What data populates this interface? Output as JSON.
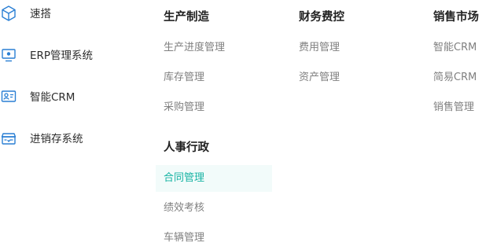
{
  "sidebar": {
    "items": [
      {
        "label": "速搭",
        "icon": "cube-icon"
      },
      {
        "label": "ERP管理系统",
        "icon": "monitor-icon"
      },
      {
        "label": "智能CRM",
        "icon": "contact-card-icon"
      },
      {
        "label": "进销存系统",
        "icon": "inventory-box-icon"
      }
    ]
  },
  "groups": {
    "manufacturing": {
      "title": "生产制造",
      "links": [
        "生产进度管理",
        "库存管理",
        "采购管理"
      ]
    },
    "finance": {
      "title": "财务费控",
      "links": [
        "费用管理",
        "资产管理"
      ]
    },
    "sales": {
      "title": "销售市场",
      "links": [
        "智能CRM",
        "简易CRM",
        "销售管理"
      ]
    },
    "hr": {
      "title": "人事行政",
      "links": [
        "合同管理",
        "绩效考核",
        "车辆管理"
      ],
      "active_index": 0
    }
  },
  "colors": {
    "accent": "#17b3a3",
    "active_bg": "#f2fbfa",
    "icon_stroke": "#2a7fd4"
  }
}
